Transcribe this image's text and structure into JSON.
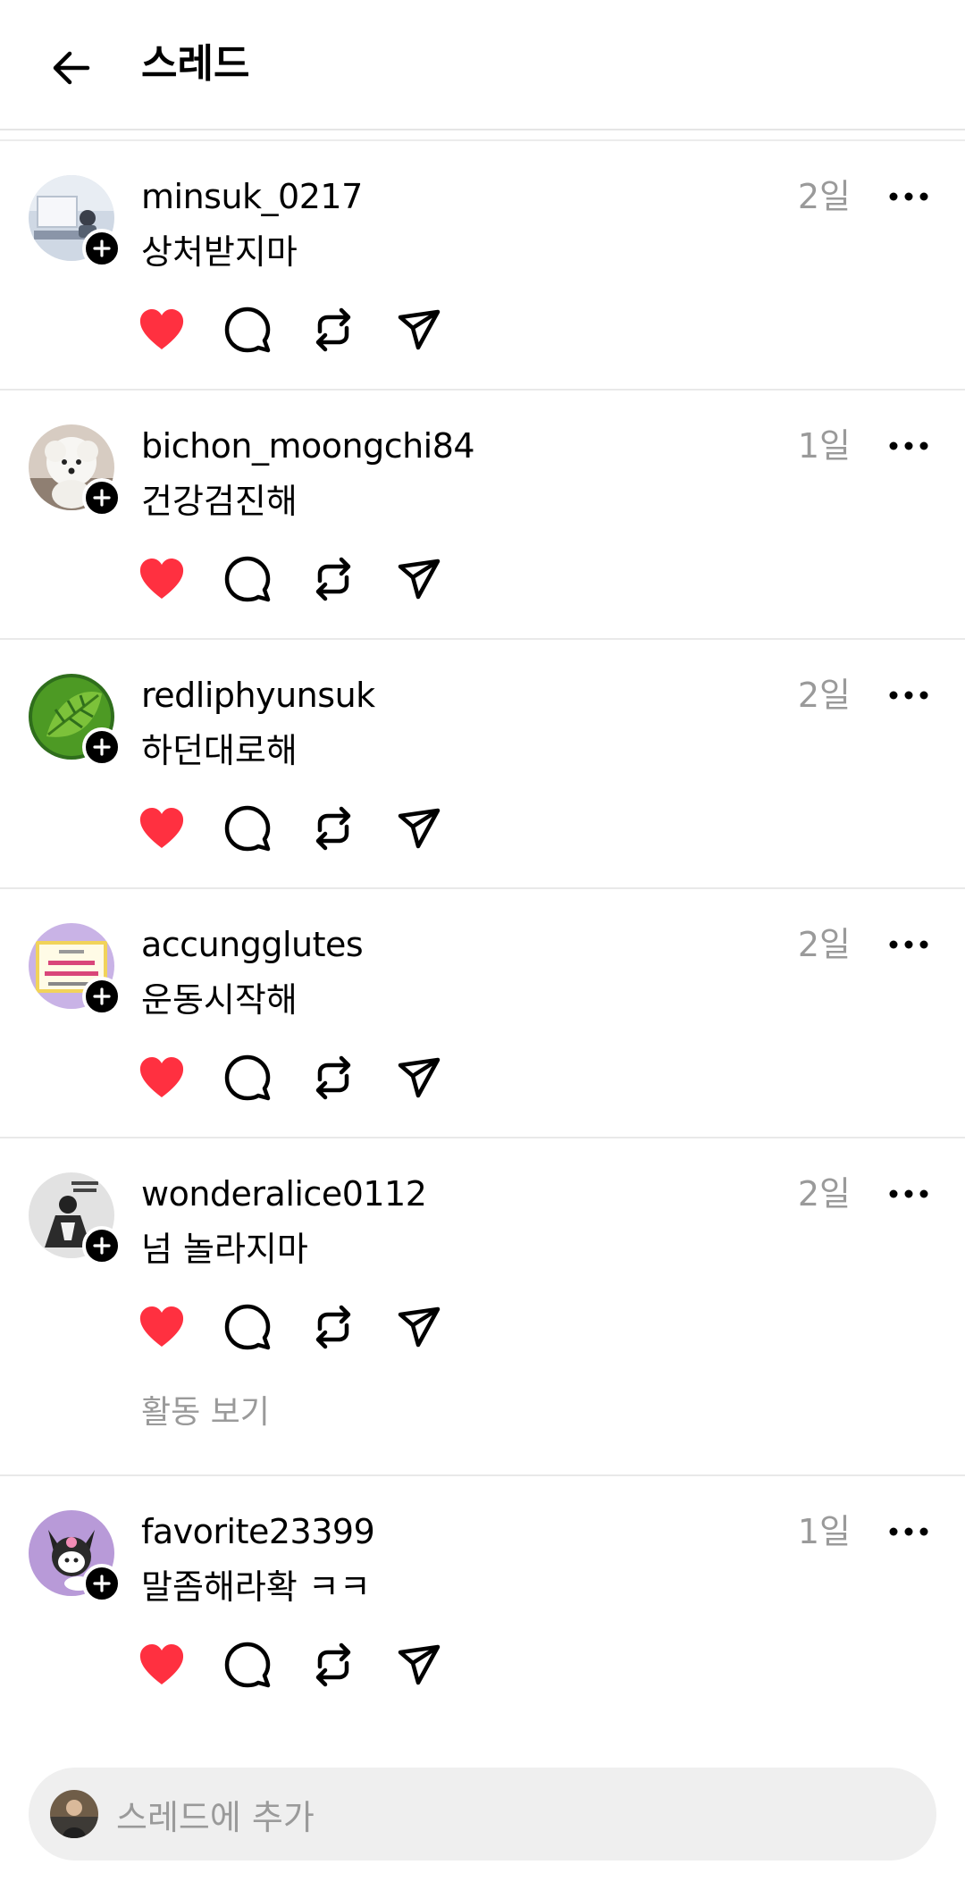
{
  "header": {
    "title": "스레드"
  },
  "colors": {
    "like": "#ff3040",
    "muted": "#9a9a9a"
  },
  "posts": [
    {
      "username": "minsuk_0217",
      "time": "2일",
      "text": "상처받지마"
    },
    {
      "username": "bichon_moongchi84",
      "time": "1일",
      "text": "건강검진해"
    },
    {
      "username": "redliphyunsuk",
      "time": "2일",
      "text": "하던대로해"
    },
    {
      "username": "accungglutes",
      "time": "2일",
      "text": "운동시작해"
    },
    {
      "username": "wonderalice0112",
      "time": "2일",
      "text": "넘 놀라지마",
      "activity": "활동 보기"
    },
    {
      "username": "favorite23399",
      "time": "1일",
      "text": "말좀해라확 ㅋㅋ"
    }
  ],
  "composer": {
    "placeholder": "스레드에 추가"
  }
}
